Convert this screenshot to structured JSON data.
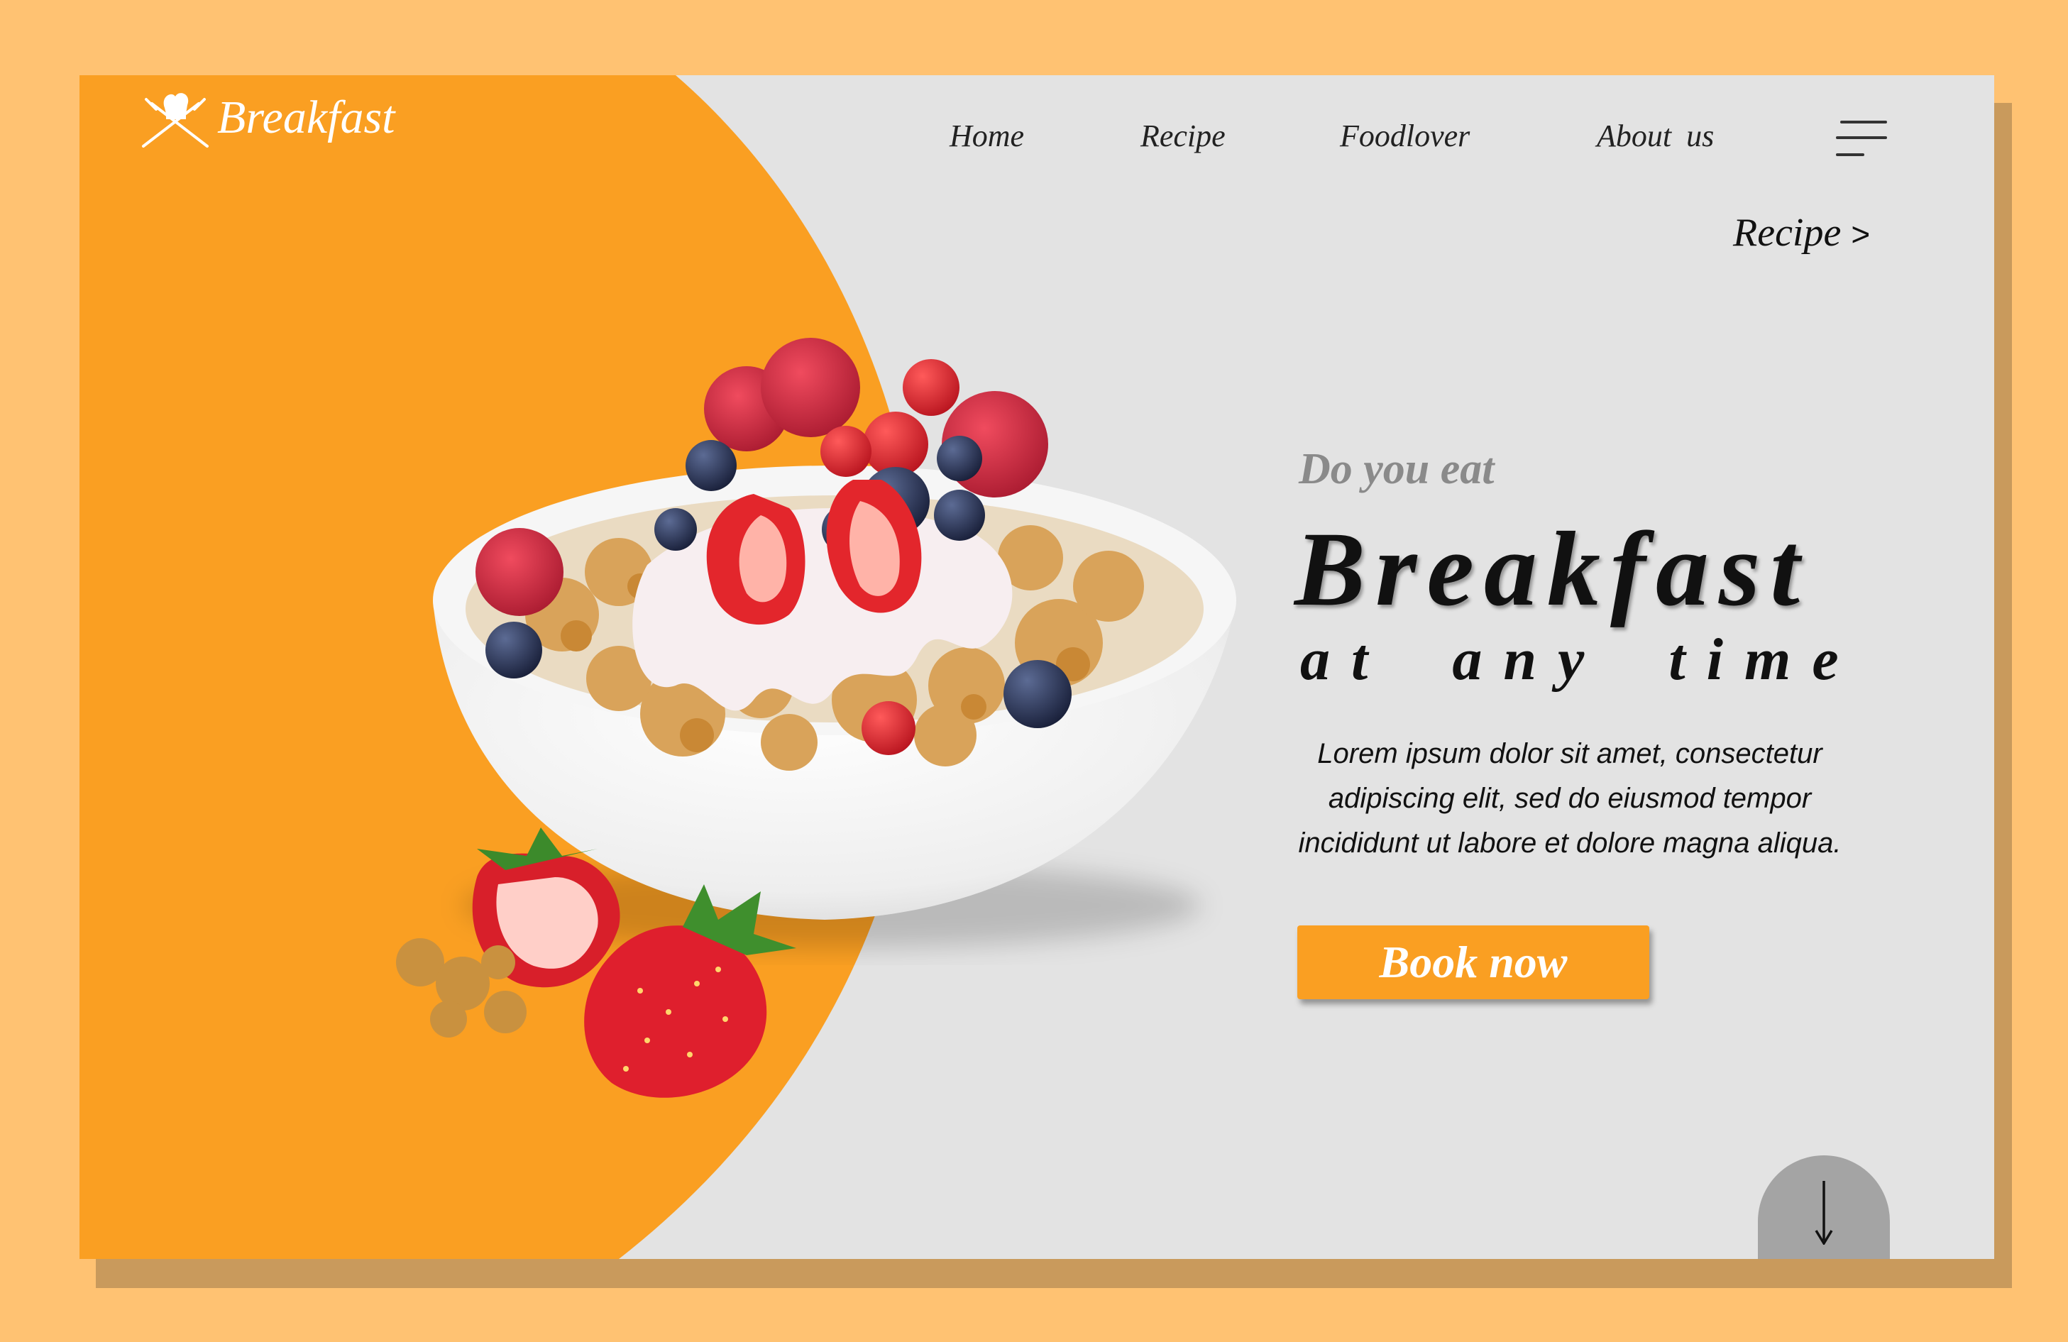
{
  "brand": {
    "name": "Breakfast",
    "logo_icon": "chef-hat-crossed-utensils-icon"
  },
  "nav": {
    "items": [
      {
        "label": "Home"
      },
      {
        "label": "Recipe"
      },
      {
        "label": "Foodlover"
      },
      {
        "label": "About us"
      }
    ],
    "menu_icon": "hamburger-menu-icon"
  },
  "breadcrumb": {
    "label": "Recipe",
    "chevron": ">"
  },
  "hero": {
    "eyebrow": "Do you eat",
    "headline": "Breakfast",
    "subheadline": "at any time",
    "body": "Lorem ipsum dolor sit amet, consectetur adipiscing elit, sed do eiusmod tempor incididunt ut labore et dolore magna aliqua.",
    "cta_label": "Book now",
    "image_icon": "granola-yogurt-berry-bowl-icon"
  },
  "scroll": {
    "icon": "arrow-down-icon"
  },
  "colors": {
    "background": "#ffc272",
    "accent": "#fa9f22",
    "card": "#e3e3e3",
    "shadow": "#c99a5c",
    "text": "#111111",
    "muted": "#8a8a8a",
    "scroll_button": "#a4a4a4"
  }
}
